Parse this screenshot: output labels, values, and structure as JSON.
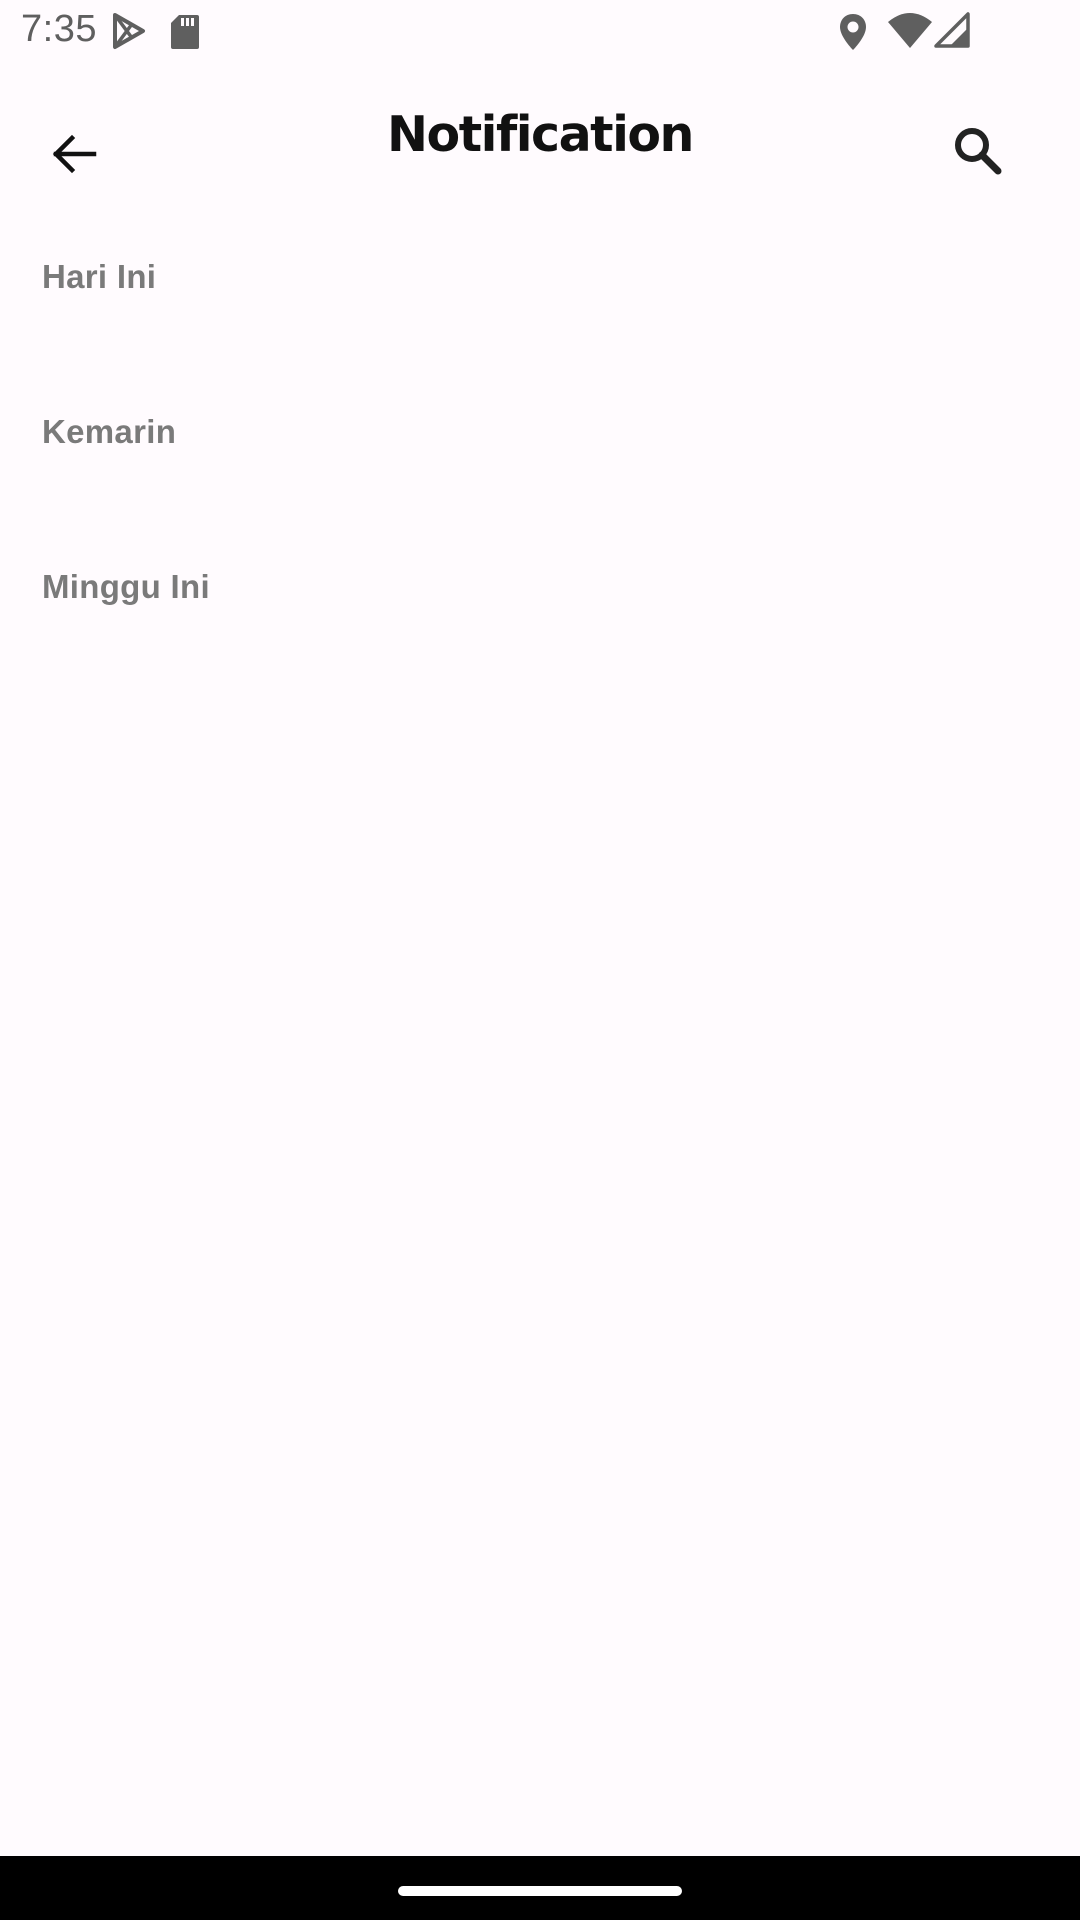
{
  "status_bar": {
    "time": "7:35",
    "left_icons": [
      "play-store-icon",
      "sd-card-icon"
    ],
    "right_icons": [
      "location-icon",
      "wifi-icon",
      "cell-signal-icon"
    ]
  },
  "app_bar": {
    "title": "Notification",
    "back_icon": "arrow-back-icon",
    "search_icon": "search-icon"
  },
  "sections": [
    {
      "label": "Hari Ini"
    },
    {
      "label": "Kemarin"
    },
    {
      "label": "Minggu Ini"
    }
  ],
  "colors": {
    "background": "#fffbfe",
    "title": "#111111",
    "section_header": "#7a7a7a",
    "status_icons": "#5f5f5f",
    "nav_bar": "#000000"
  }
}
